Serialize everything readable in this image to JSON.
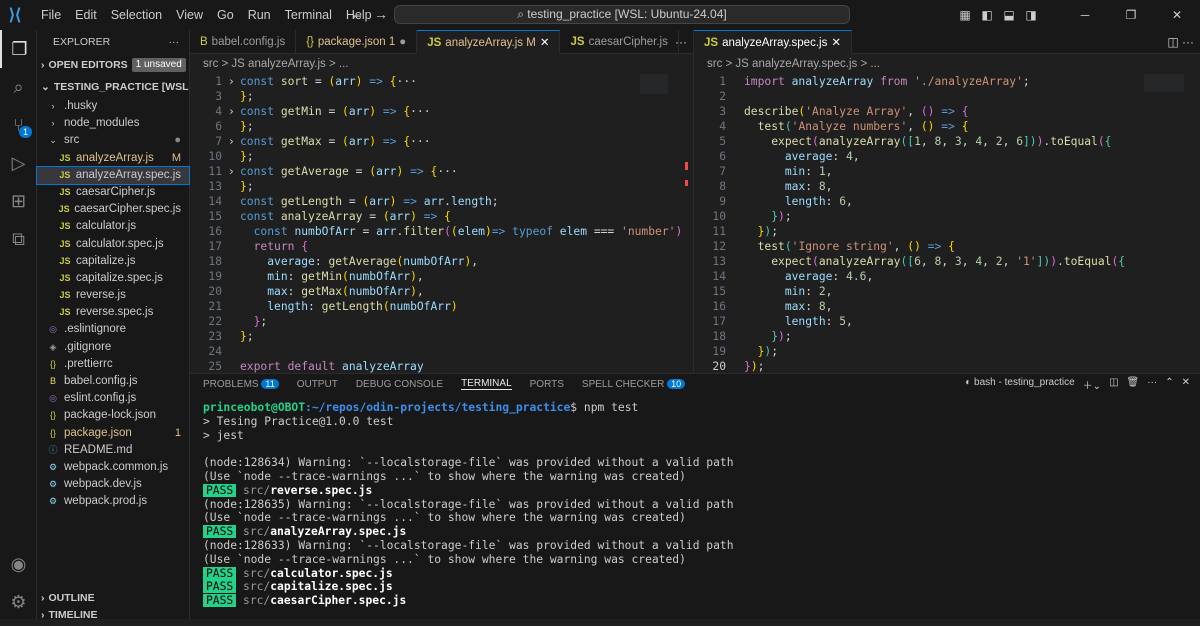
{
  "menu": [
    "File",
    "Edit",
    "Selection",
    "View",
    "Go",
    "Run",
    "Terminal",
    "Help"
  ],
  "title": "testing_practice [WSL: Ubuntu-24.04]",
  "explorer": {
    "title": "EXPLORER",
    "open_editors": "OPEN EDITORS",
    "unsaved": "1 unsaved",
    "project": "TESTING_PRACTICE [WSL: UBU...",
    "outline": "OUTLINE",
    "timeline": "TIMELINE",
    "items": [
      {
        "label": ".husky",
        "icon": "chevron-right",
        "type": "folder"
      },
      {
        "label": "node_modules",
        "icon": "chevron-right",
        "type": "folder"
      },
      {
        "label": "src",
        "icon": "chevron-down",
        "type": "folder",
        "status": "●"
      },
      {
        "label": "analyzeArray.js",
        "icon": "JS",
        "status": "M",
        "indent": 1
      },
      {
        "label": "analyzeArray.spec.js",
        "icon": "JS",
        "indent": 1,
        "selected": true
      },
      {
        "label": "caesarCipher.js",
        "icon": "JS",
        "indent": 1
      },
      {
        "label": "caesarCipher.spec.js",
        "icon": "JS",
        "indent": 1
      },
      {
        "label": "calculator.js",
        "icon": "JS",
        "indent": 1
      },
      {
        "label": "calculator.spec.js",
        "icon": "JS",
        "indent": 1
      },
      {
        "label": "capitalize.js",
        "icon": "JS",
        "indent": 1
      },
      {
        "label": "capitalize.spec.js",
        "icon": "JS",
        "indent": 1
      },
      {
        "label": "reverse.js",
        "icon": "JS",
        "indent": 1
      },
      {
        "label": "reverse.spec.js",
        "icon": "JS",
        "indent": 1
      },
      {
        "label": ".eslintignore",
        "icon": "◎"
      },
      {
        "label": ".gitignore",
        "icon": "◈"
      },
      {
        "label": ".prettierrc",
        "icon": "{}"
      },
      {
        "label": "babel.config.js",
        "icon": "B"
      },
      {
        "label": "eslint.config.js",
        "icon": "◎"
      },
      {
        "label": "package-lock.json",
        "icon": "{}"
      },
      {
        "label": "package.json",
        "icon": "{}",
        "status": "1"
      },
      {
        "label": "README.md",
        "icon": "ⓘ"
      },
      {
        "label": "webpack.common.js",
        "icon": "⚙"
      },
      {
        "label": "webpack.dev.js",
        "icon": "⚙"
      },
      {
        "label": "webpack.prod.js",
        "icon": "⚙"
      }
    ]
  },
  "left_tabs": [
    "babel.config.js",
    "package.json 1",
    "analyzeArray.js M",
    "caesarCipher.js"
  ],
  "left_crumb": "src > JS analyzeArray.js > ...",
  "right_tab": "analyzeArray.spec.js",
  "right_crumb": "src > JS analyzeArray.spec.js > ...",
  "panel_tabs": [
    "PROBLEMS",
    "OUTPUT",
    "DEBUG CONSOLE",
    "TERMINAL",
    "PORTS",
    "SPELL CHECKER"
  ],
  "problems_count": "11",
  "spell_count": "10",
  "terminal_name": "bash - testing_practice",
  "terminal": {
    "user": "princeobot@OBOT",
    "path": ":~/repos/odin-projects/testing_practice",
    "cmd": "$ npm test",
    "l1": "> Tesing Practice@1.0.0 test",
    "l2": "> jest",
    "warn1": "(node:128634) Warning: `--localstorage-file` was provided without a valid path",
    "use1": "(Use `node --trace-warnings ...` to show where the warning was created)",
    "warn2": "(node:128635) Warning: `--localstorage-file` was provided without a valid path",
    "use2": "(Use `node --trace-warnings ...` to show where the warning was created)",
    "warn3": "(node:128633) Warning: `--localstorage-file` was provided without a valid path",
    "use3": "(Use `node --trace-warnings ...` to show where the warning was created)",
    "pass": "PASS",
    "src": "src/",
    "p1": "reverse.spec.js",
    "p2": "analyzeArray.spec.js",
    "p3": "calculator.spec.js",
    "p4": "capitalize.spec.js",
    "p5": "caesarCipher.spec.js"
  }
}
